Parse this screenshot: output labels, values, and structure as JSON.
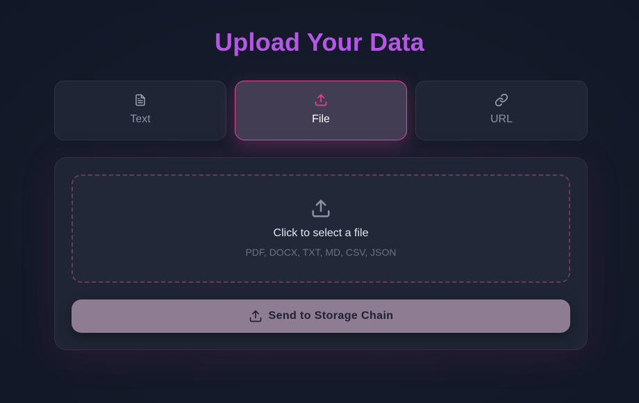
{
  "header": {
    "title": "Upload Your Data"
  },
  "tabs": [
    {
      "label": "Text",
      "icon": "document-icon",
      "active": false
    },
    {
      "label": "File",
      "icon": "upload-icon",
      "active": true
    },
    {
      "label": "URL",
      "icon": "link-icon",
      "active": false
    }
  ],
  "dropzone": {
    "icon": "upload-icon",
    "title": "Click to select a file",
    "formats": "PDF, DOCX, TXT, MD, CSV, JSON"
  },
  "submit": {
    "label": "Send to Storage Chain",
    "icon": "upload-icon"
  },
  "colors": {
    "background": "#141a29",
    "title": "#b656e6",
    "accent": "#e0459a",
    "card": "#1f2534",
    "button": "#8e7c93"
  }
}
